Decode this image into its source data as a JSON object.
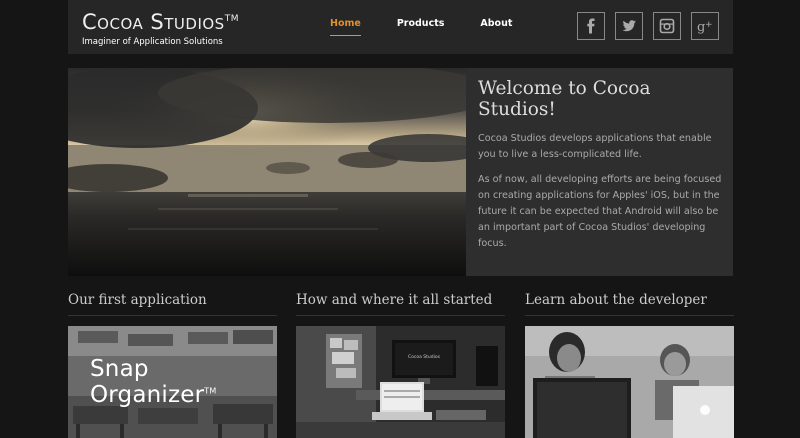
{
  "header": {
    "logo_title": "Cocoa Studios",
    "logo_tm": "TM",
    "tagline": "Imaginer of Application Solutions",
    "nav": [
      {
        "label": "Home",
        "active": true
      },
      {
        "label": "Products",
        "active": false
      },
      {
        "label": "About",
        "active": false
      }
    ],
    "social": [
      "facebook-icon",
      "twitter-icon",
      "instagram-icon",
      "google-plus-icon"
    ]
  },
  "hero": {
    "title": "Welcome to Cocoa Studios!",
    "p1": "Cocoa Studios develops applications that enable you to live a less-complicated life.",
    "p2": "As of now, all developing efforts are being focused on creating applications for Apples' iOS, but in the future it can be expected that Android will also be an important part of Cocoa Studios' developing focus."
  },
  "columns": [
    {
      "title": "Our first application",
      "overlay": "Snap Organizer",
      "overlay_tm": "TM"
    },
    {
      "title": "How and where it all started",
      "screen_text": "Cocoa Studios"
    },
    {
      "title": "Learn about the developer"
    }
  ],
  "colors": {
    "accent": "#e0912e",
    "header_bg": "#262626",
    "page_bg": "#151515",
    "panel_bg": "#2e2e2e"
  }
}
